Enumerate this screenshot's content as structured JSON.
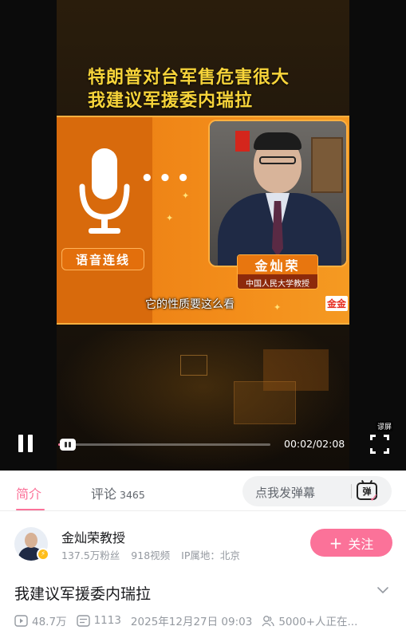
{
  "video": {
    "banner_line1": "特朗普对台军售危害很大",
    "banner_line2": "我建议军援委内瑞拉",
    "voice_label": "语音连线",
    "guest_name": "金灿荣",
    "guest_title": "中国人民大学教授",
    "subtitle": "它的性质要这么看",
    "channel_logo": "金金",
    "progress": 0.016
  },
  "controls": {
    "time": "00:02/02:08",
    "fullscreen_lock": "谬屏"
  },
  "tabs": {
    "intro": "简介",
    "comments": "评论",
    "comments_count": "3465",
    "danmaku_placeholder": "点我发弹幕",
    "danmaku_toggle": "弹"
  },
  "uploader": {
    "name": "金灿荣教授",
    "fans": "137.5万粉丝",
    "videos": "918视频",
    "ip": "IP属地：北京",
    "follow_label": "关注"
  },
  "info": {
    "title": "我建议军援委内瑞拉",
    "views": "48.7万",
    "danmaku_count": "1113",
    "date": "2025年12月27日 09:03",
    "watching": "5000+人正在..."
  },
  "colors": {
    "accent": "#fb7299",
    "banner_text": "#f7d43a",
    "panel_orange": "#f38d1a"
  },
  "icons": [
    "pause-icon",
    "fullscreen-icon",
    "danmaku-toggle-icon",
    "views-icon",
    "danmaku-count-icon",
    "watching-icon",
    "chevron-down-icon"
  ]
}
